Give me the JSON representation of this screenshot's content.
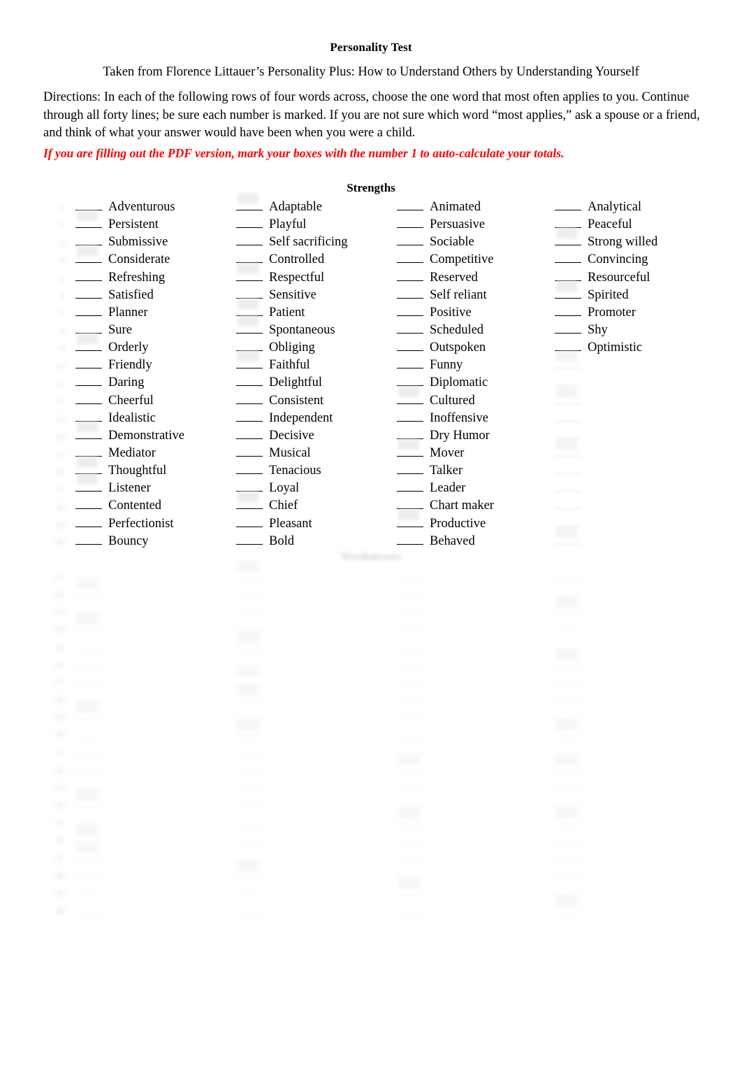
{
  "document": {
    "title": "Personality Test",
    "attribution": "Taken from Florence Littauer’s Personality Plus: How to Understand Others by Understanding Yourself",
    "directions": "Directions: In each of the following rows of four words across, choose the one word that most often applies to you. Continue through all forty lines; be sure each number is marked. If you are not sure which word “most applies,” ask a spouse or a friend, and think of what your answer would have been when you were a child.",
    "pdf_note": "If  you are filling out the PDF version, mark your boxes with the number 1 to auto-calculate your totals.",
    "accent_color": "#ff0000",
    "text_color": "#000000"
  },
  "sections": {
    "strengths": {
      "heading": "Strengths",
      "columns": [
        {
          "name": "column-1",
          "words": [
            "Adventurous",
            "Persistent",
            "Submissive",
            "Considerate",
            "Refreshing",
            "Satisfied",
            "Planner",
            "Sure",
            "Orderly",
            "Friendly",
            "Daring",
            "Cheerful",
            "Idealistic",
            "Demonstrative",
            "Mediator",
            "Thoughtful",
            "Listener",
            "Contented",
            "Perfectionist",
            "Bouncy"
          ]
        },
        {
          "name": "column-2",
          "words": [
            "Adaptable",
            "Playful",
            "Self sacrificing",
            "Controlled",
            "Respectful",
            "Sensitive",
            "Patient",
            "Spontaneous",
            "Obliging",
            "Faithful",
            "Delightful",
            "Consistent",
            "Independent",
            "Decisive",
            "Musical",
            "Tenacious",
            "Loyal",
            "Chief",
            "Pleasant",
            "Bold"
          ]
        },
        {
          "name": "column-3",
          "words": [
            "Animated",
            "Persuasive",
            "Sociable",
            "Competitive",
            "Reserved",
            "Self reliant",
            "Positive",
            "Scheduled",
            "Outspoken",
            "Funny",
            "Diplomatic",
            "Cultured",
            "Inoffensive",
            "Dry Humor",
            "Mover",
            "Talker",
            "Leader",
            "Chart maker",
            "Productive",
            "Behaved"
          ]
        },
        {
          "name": "column-4",
          "words": [
            "Analytical",
            "Peaceful",
            "Strong willed",
            "Convincing",
            "Resourceful",
            "Spirited",
            "Promoter",
            "Shy",
            "Optimistic",
            "",
            "",
            "",
            "",
            "",
            "",
            "",
            "",
            "",
            "",
            ""
          ]
        }
      ]
    },
    "weaknesses": {
      "heading": "Weaknesses",
      "columns": [
        {
          "name": "column-1",
          "words": [
            "",
            "",
            "",
            "",
            "",
            "",
            "",
            "",
            "",
            "",
            "",
            "",
            "",
            "",
            "",
            "",
            "",
            "",
            "",
            ""
          ]
        },
        {
          "name": "column-2",
          "words": [
            "",
            "",
            "",
            "",
            "",
            "",
            "",
            "",
            "",
            "",
            "",
            "",
            "",
            "",
            "",
            "",
            "",
            "",
            "",
            ""
          ]
        },
        {
          "name": "column-3",
          "words": [
            "",
            "",
            "",
            "",
            "",
            "",
            "",
            "",
            "",
            "",
            "",
            "",
            "",
            "",
            "",
            "",
            "",
            "",
            "",
            ""
          ]
        },
        {
          "name": "column-4",
          "words": [
            "",
            "",
            "",
            "",
            "",
            "",
            "",
            "",
            "",
            "",
            "",
            "",
            "",
            "",
            "",
            "",
            "",
            "",
            "",
            ""
          ]
        }
      ]
    }
  },
  "margin_numbers": {
    "strengths": "1\n2\n3\n4\n5\n6\n7\n8\n9\n10\n11\n12\n13\n14\n15\n16\n17\n18\n19\n20",
    "weaknesses": "21\n22\n23\n24\n25\n26\n27\n28\n29\n30\n31\n32\n33\n34\n35\n36\n37\n38\n39\n40"
  }
}
